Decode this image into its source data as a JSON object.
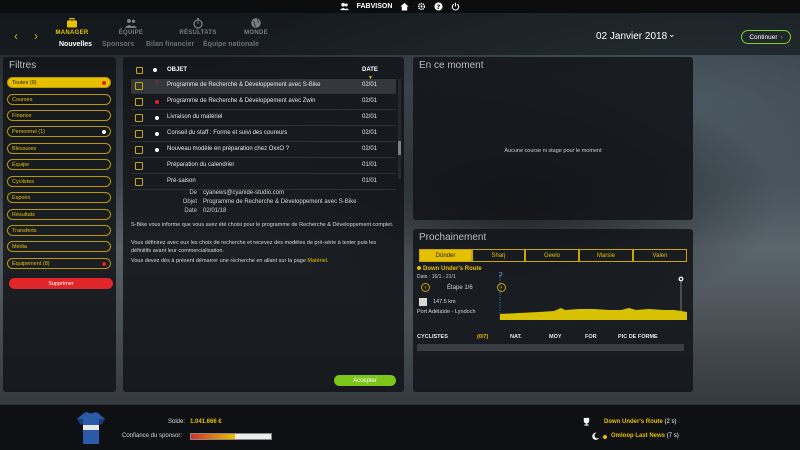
{
  "topbar": {
    "username": "FABVISON"
  },
  "nav": {
    "tabs": [
      {
        "label": "MANAGER",
        "state": "active"
      },
      {
        "label": "ÉQUIPE",
        "state": "inactive"
      },
      {
        "label": "RÉSULTATS",
        "state": "inactive"
      },
      {
        "label": "MONDE",
        "state": "inactive"
      }
    ],
    "subtabs": [
      {
        "label": "Nouvelles",
        "state": "active"
      },
      {
        "label": "Sponsors",
        "state": "inactive"
      },
      {
        "label": "Bilan financier",
        "state": "inactive"
      },
      {
        "label": "Équipe nationale",
        "state": "inactive"
      }
    ],
    "date": "02 Janvier 2018",
    "continue_label": "Continuer"
  },
  "filters": {
    "title": "Filtres",
    "items": [
      {
        "label": "Toutes (9)",
        "active": true,
        "dot": "red"
      },
      {
        "label": "Courses",
        "active": false,
        "dot": ""
      },
      {
        "label": "Finance",
        "active": false,
        "dot": ""
      },
      {
        "label": "Personnel (1)",
        "active": false,
        "dot": "white"
      },
      {
        "label": "Blessures",
        "active": false,
        "dot": ""
      },
      {
        "label": "Équipe",
        "active": false,
        "dot": ""
      },
      {
        "label": "Cyclistes",
        "active": false,
        "dot": ""
      },
      {
        "label": "Espoirs",
        "active": false,
        "dot": ""
      },
      {
        "label": "Résultats",
        "active": false,
        "dot": ""
      },
      {
        "label": "Transferts",
        "active": false,
        "dot": ""
      },
      {
        "label": "Média",
        "active": false,
        "dot": ""
      },
      {
        "label": "Équipement (8)",
        "active": false,
        "dot": "red"
      }
    ],
    "delete_label": "Supprimer"
  },
  "messages": {
    "col_subject": "OBJET",
    "col_date": "DATE",
    "rows": [
      {
        "subject": "Programme de Recherche & Développement avec S-Bike",
        "date": "02/01",
        "mark": "!",
        "selected": true
      },
      {
        "subject": "Programme de Recherche & Développement avec Zwin",
        "date": "02/01",
        "mark": "red",
        "selected": false
      },
      {
        "subject": "Livraison du matériel",
        "date": "02/01",
        "mark": "white",
        "selected": false
      },
      {
        "subject": "Conseil du staff : Forme et suivi des coureurs",
        "date": "02/01",
        "mark": "white",
        "selected": false
      },
      {
        "subject": "Nouveau modèle en préparation chez OxxO ?",
        "date": "02/01",
        "mark": "white",
        "selected": false
      },
      {
        "subject": "Préparation du calendrier",
        "date": "01/01",
        "mark": "",
        "selected": false
      },
      {
        "subject": "Pré-saison",
        "date": "01/01",
        "mark": "",
        "selected": false
      }
    ],
    "detail": {
      "from_label": "De",
      "from": "cyanews@cyanide-studio.com",
      "object_label": "Objet",
      "object": "Programme de Recherche & Développement avec S-Bike",
      "date_label": "Date",
      "date": "02/01/18",
      "para1": "S-Bike vous informe que vous avez été choisi pour le programme de Recherche & Développement complet.",
      "para2": "Vous définirez avec eux les choix de recherche et recevez des modèles de pré-série à tester puis les définitifs avant leur commercialisation.",
      "para3_prefix": "Vous devez dès à présent démarrer une recherche en allant sur la page ",
      "para3_link": "Matériel",
      "para3_suffix": "."
    },
    "accept_label": "Accepter"
  },
  "now": {
    "title": "En ce moment",
    "empty": "Aucune course ni stage pour le moment"
  },
  "next": {
    "title": "Prochainement",
    "race_tabs": [
      "Dünder",
      "Sharj",
      "Geelo",
      "Marsie",
      "Valen"
    ],
    "race_name": "Down Under's Route",
    "race_dates": "Date : 16/1 - 21/1",
    "stage": "Étape 1/6",
    "distance": "147.5 km",
    "route": "Port Adélaïde - Lyndoch",
    "cyc_cols": [
      "CYCLISTES",
      "(0/7)",
      "NAT.",
      "MOY",
      "FOR",
      "PIC DE FORME"
    ]
  },
  "bottom": {
    "solde_label": "Solde:",
    "solde_value": "1.041.666 €",
    "confidence_label": "Confiance du sponsor:",
    "confidence_pct": 55,
    "events": [
      {
        "label": "Down Under's Route",
        "count": "(2 s)"
      },
      {
        "label": "Omloop Last News",
        "count": "(7 s)"
      }
    ]
  },
  "colors": {
    "accent": "#e6c000",
    "accept": "#7cc51a",
    "delete": "#e0262a"
  }
}
